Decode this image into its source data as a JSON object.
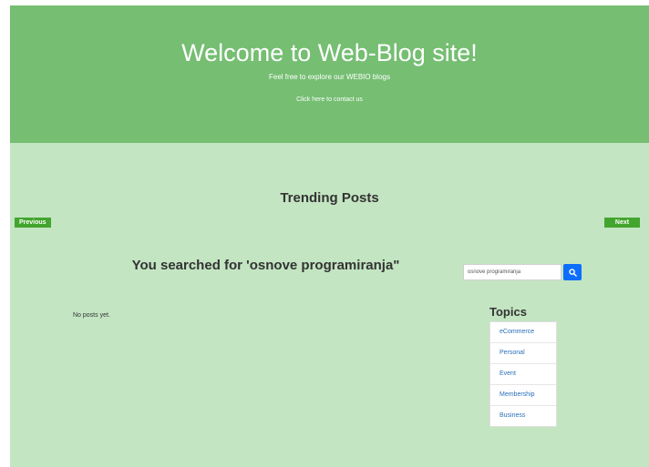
{
  "hero": {
    "title": "Welcome to Web-Blog site!",
    "subtitle": "Feel free to explore our WEBIO blogs",
    "contact_link": "Click here to contact us"
  },
  "trending": {
    "title": "Trending Posts",
    "prev_label": "Previous",
    "next_label": "Next"
  },
  "search": {
    "heading": "You searched for 'osnove programiranja\"",
    "query": "osnove programiranja",
    "button_icon": "search-icon",
    "empty_message": "No posts yet."
  },
  "topics": {
    "title": "Topics",
    "items": [
      "eCommerce",
      "Personal",
      "Event",
      "Membership",
      "Business"
    ]
  },
  "colors": {
    "hero_bg": "#75be72",
    "page_bg": "#c3e5c2",
    "nav_button": "#42a52d",
    "search_button": "#0d6efd",
    "topic_link": "#2a6fb8"
  }
}
